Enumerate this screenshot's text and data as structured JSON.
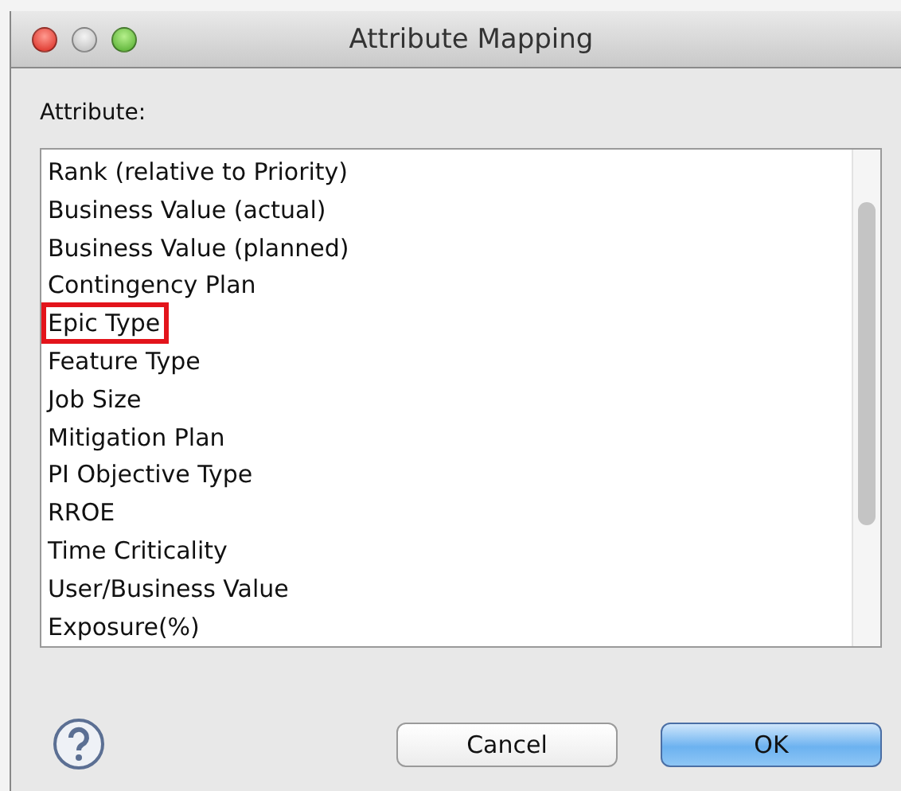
{
  "window": {
    "title": "Attribute Mapping"
  },
  "label": "Attribute:",
  "attributes": [
    {
      "name": "Rank (relative to Priority)",
      "highlighted": false
    },
    {
      "name": "Business Value (actual)",
      "highlighted": false
    },
    {
      "name": "Business Value (planned)",
      "highlighted": false
    },
    {
      "name": "Contingency Plan",
      "highlighted": false
    },
    {
      "name": "Epic Type",
      "highlighted": true
    },
    {
      "name": "Feature Type",
      "highlighted": false
    },
    {
      "name": "Job Size",
      "highlighted": false
    },
    {
      "name": "Mitigation Plan",
      "highlighted": false
    },
    {
      "name": "PI Objective Type",
      "highlighted": false
    },
    {
      "name": "RROE",
      "highlighted": false
    },
    {
      "name": "Time Criticality",
      "highlighted": false
    },
    {
      "name": "User/Business Value",
      "highlighted": false
    },
    {
      "name": "Exposure(%)",
      "highlighted": false
    }
  ],
  "buttons": [
    {
      "label": "Cancel",
      "kind": "secondary"
    },
    {
      "label": "OK",
      "kind": "primary"
    }
  ]
}
